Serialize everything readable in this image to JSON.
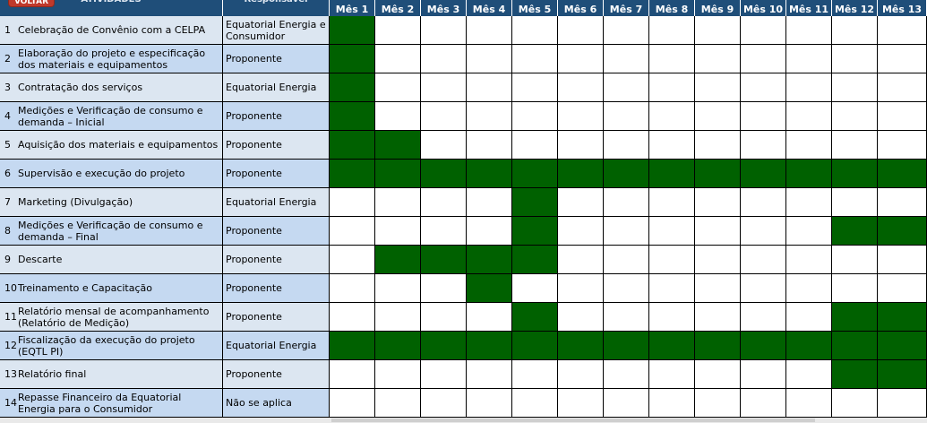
{
  "header": {
    "voltar_label": "VOLTAR",
    "atividades_label": "ATIVIDADES",
    "responsavel_label": "Responsável",
    "months": [
      "Mês 1",
      "Mês 2",
      "Mês 3",
      "Mês 4",
      "Mês 5",
      "Mês 6",
      "Mês 7",
      "Mês 8",
      "Mês 9",
      "Mês 10",
      "Mês 11",
      "Mês 12",
      "Mês 13"
    ]
  },
  "colors": {
    "header_bg": "#1f4e79",
    "row_odd_bg": "#dce6f1",
    "row_even_bg": "#c5d9f1",
    "filled_month": "#006100",
    "voltar_button": "#c0392b"
  },
  "rows": [
    {
      "num": "1",
      "activity": "Celebração de Convênio com a CELPA",
      "responsible": "Equatorial Energia e Consumidor",
      "months": [
        1
      ]
    },
    {
      "num": "2",
      "activity": "Elaboração do projeto e especificação dos materiais e equipamentos",
      "responsible": "Proponente",
      "months": [
        1
      ]
    },
    {
      "num": "3",
      "activity": "Contratação dos serviços",
      "responsible": "Equatorial Energia",
      "months": [
        1
      ]
    },
    {
      "num": "4",
      "activity": "Medições e Verificação de consumo e demanda – Inicial",
      "responsible": "Proponente",
      "months": [
        1
      ]
    },
    {
      "num": "5",
      "activity": "Aquisição dos materiais e equipamentos",
      "responsible": "Proponente",
      "months": [
        1,
        2
      ]
    },
    {
      "num": "6",
      "activity": "Supervisão e execução do projeto",
      "responsible": "Proponente",
      "months": [
        1,
        2,
        3,
        4,
        5,
        6,
        7,
        8,
        9,
        10,
        11,
        12,
        13
      ]
    },
    {
      "num": "7",
      "activity": "Marketing (Divulgação)",
      "responsible": "Equatorial Energia",
      "months": [
        5
      ]
    },
    {
      "num": "8",
      "activity": "Medições e Verificação de consumo e demanda – Final",
      "responsible": "Proponente",
      "months": [
        5,
        12,
        13
      ]
    },
    {
      "num": "9",
      "activity": "Descarte",
      "responsible": "Proponente",
      "months": [
        2,
        3,
        4,
        5
      ]
    },
    {
      "num": "10",
      "activity": "Treinamento e Capacitação",
      "responsible": "Proponente",
      "months": [
        4
      ]
    },
    {
      "num": "11",
      "activity": "Relatório mensal de acompanhamento (Relatório de Medição)",
      "responsible": "Proponente",
      "months": [
        5,
        12,
        13
      ]
    },
    {
      "num": "12",
      "activity": "Fiscalização da execução do projeto (EQTL PI)",
      "responsible": "Equatorial Energia",
      "months": [
        1,
        2,
        3,
        4,
        5,
        6,
        7,
        8,
        9,
        10,
        11,
        12,
        13
      ]
    },
    {
      "num": "13",
      "activity": "Relatório final",
      "responsible": "Proponente",
      "months": [
        12,
        13
      ]
    },
    {
      "num": "14",
      "activity": "Repasse Financeiro da Equatorial Energia para o Consumidor",
      "responsible": "Não se aplica",
      "months": []
    }
  ]
}
